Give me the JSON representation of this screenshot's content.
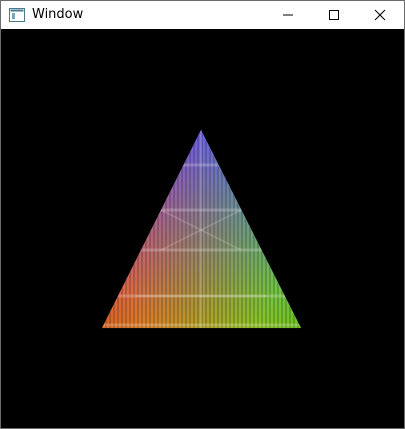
{
  "window": {
    "title": "Window",
    "controls": {
      "minimize_icon": "minimize-icon",
      "maximize_icon": "maximize-icon",
      "close_icon": "close-icon"
    }
  },
  "scene": {
    "background": "#000000",
    "vertex_colors": {
      "top": "#2020ff",
      "bottom_left": "#ff1a1a",
      "bottom_right": "#1aff1a"
    }
  }
}
